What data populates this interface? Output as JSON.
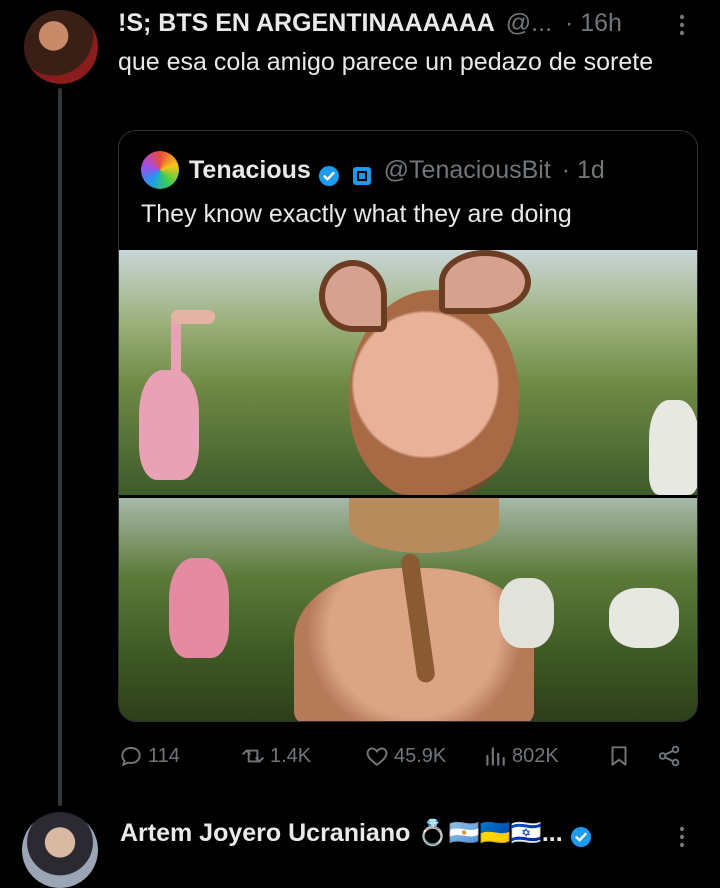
{
  "tweet": {
    "author_name": "!S; BTS EN ARGENTINAAAAAA",
    "handle": "@...",
    "time": "· 16h",
    "text": "que esa cola amigo parece un pedazo de sorete",
    "more_icon": "more-vertical-icon"
  },
  "quote": {
    "author_name": "Tenacious",
    "handle": "@TenaciousBit",
    "time": "· 1d",
    "text": "They know exactly what they are doing",
    "verified_color": "#1d9bf0",
    "affiliate_icon": "square-badge-icon"
  },
  "actions": {
    "replies": "114",
    "retweets": "1.4K",
    "likes": "45.9K",
    "views": "802K"
  },
  "next_tweet": {
    "author_name": "Artem Joyero Ucraniano",
    "emoji_suffix": "💍🇦🇷🇺🇦🇮🇱...",
    "verified_color": "#1d9bf0"
  },
  "colors": {
    "background": "#000000",
    "text": "#e7e9ea",
    "muted": "#71767b",
    "border": "#2f3336",
    "accent": "#1d9bf0"
  }
}
